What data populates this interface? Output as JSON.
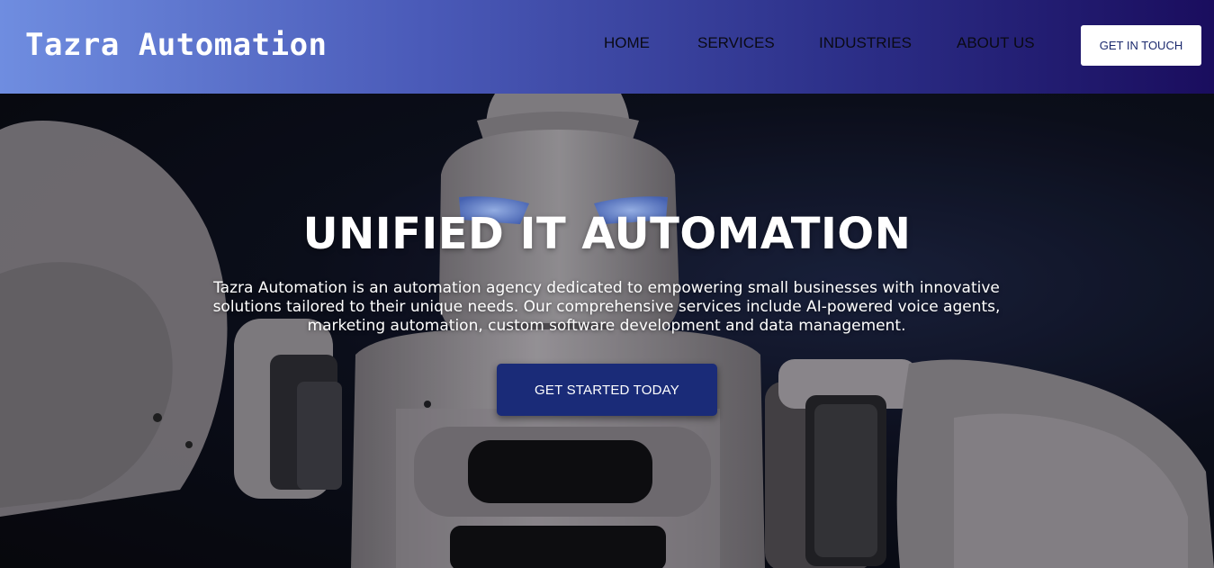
{
  "brand": {
    "name": "Tazra Automation"
  },
  "nav": {
    "items": [
      {
        "label": "HOME"
      },
      {
        "label": "SERVICES"
      },
      {
        "label": "INDUSTRIES"
      },
      {
        "label": "ABOUT US"
      }
    ],
    "cta_label": "GET IN TOUCH"
  },
  "hero": {
    "title": "UNIFIED IT AUTOMATION",
    "description": "Tazra Automation is an automation agency dedicated to empowering small businesses with innovative solutions tailored to their unique needs. Our comprehensive services include AI-powered voice agents, marketing automation, custom software development and data management.",
    "cta_label": "GET STARTED TODAY",
    "background_image": "robot-photo"
  },
  "colors": {
    "header_gradient_start": "#6f8de0",
    "header_gradient_end": "#1a0d5e",
    "hero_cta_bg": "#1a2b78",
    "top_cta_bg": "#ffffff",
    "top_cta_text": "#1c2a6e"
  }
}
